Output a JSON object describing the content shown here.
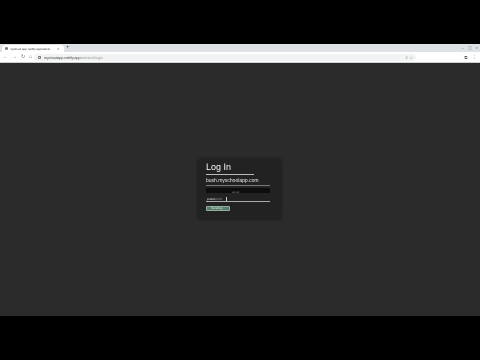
{
  "browser": {
    "tab": {
      "title": "mychool app.netlify.app/admin",
      "close": "×"
    },
    "new_tab": "+",
    "window_controls": {
      "minimize": "–",
      "maximize": "▢",
      "close": "×"
    },
    "nav": {
      "back": "←",
      "forward": "→",
      "reload": "↻",
      "home": "⌂"
    },
    "url": {
      "host": "mychoolapp.netlify.app",
      "path": "/admin/#/login"
    },
    "omnibox_icons": "⇩ ☆",
    "toolbar_icons": [
      "⧉",
      "⋮"
    ]
  },
  "login": {
    "title": "Log In",
    "email": "bush.myschoolapp.com",
    "masked_hint": "email",
    "password_placeholder": "password",
    "password_mask": "••••••",
    "submit_label": "Sending..."
  },
  "colors": {
    "page_bg": "#2b2b2b",
    "card_bg": "#222222",
    "button": "#5a7a6a"
  }
}
